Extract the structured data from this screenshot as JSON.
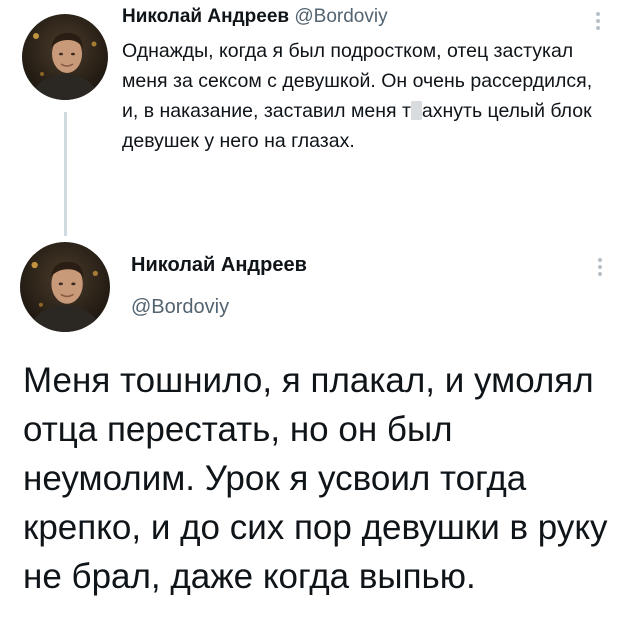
{
  "tweet1": {
    "author_name": "Николай Андреев",
    "author_handle": "@Bordoviy",
    "text_before_censor": "Однажды, когда я был подростком, отец застукал меня за сексом с девушкой. Он очень рассердился, и, в наказание, заставил меня т",
    "text_after_censor": "ахнуть целый блок девушек у него на глазах."
  },
  "tweet2": {
    "author_name": "Николай Андреев",
    "author_handle": "@Bordoviy",
    "text": "Меня тошнило, я плакал, и умолял отца перестать, но он был неумолим. Урок я усвоил тогда крепко, и до сих пор девушки в руку не брал, даже когда выпью."
  },
  "icons": {
    "more": "more-vertical-icon",
    "avatar": "avatar-photo"
  },
  "colors": {
    "text": "#0f1419",
    "secondary_text": "#536471",
    "thread_line": "#cfd9de"
  }
}
